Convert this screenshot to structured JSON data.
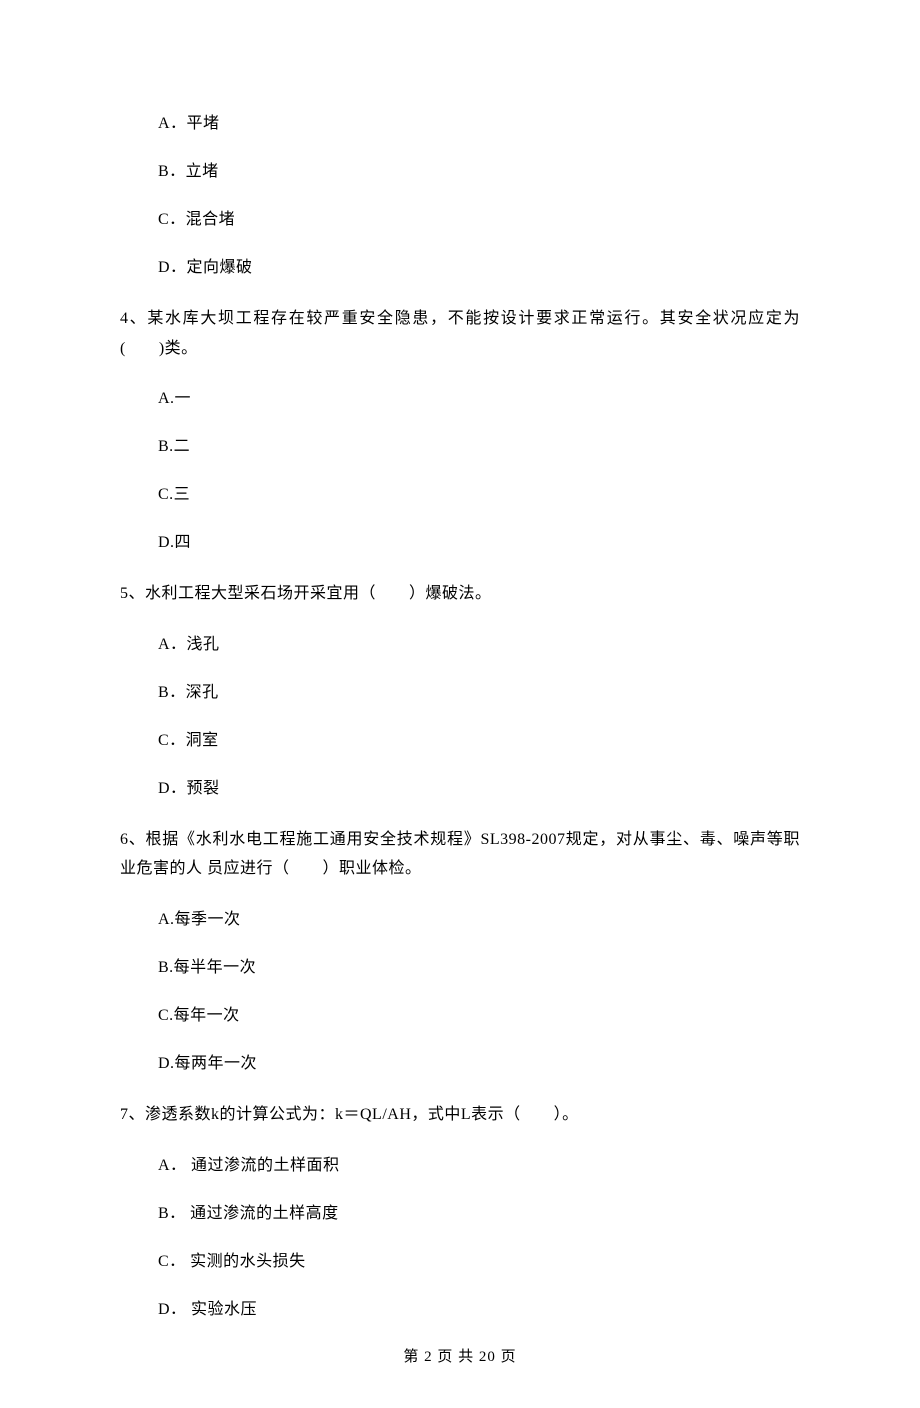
{
  "q3": {
    "options": {
      "a": "A．平堵",
      "b": "B．立堵",
      "c": "C．混合堵",
      "d": "D．定向爆破"
    }
  },
  "q4": {
    "stem": "4、某水库大坝工程存在较严重安全隐患，不能按设计要求正常运行。其安全状况应定为(　　)类。",
    "options": {
      "a": "A.一",
      "b": "B.二",
      "c": "C.三",
      "d": "D.四"
    }
  },
  "q5": {
    "stem": "5、水利工程大型采石场开采宜用（　　）爆破法。",
    "options": {
      "a": "A．浅孔",
      "b": "B．深孔",
      "c": "C．洞室",
      "d": "D．预裂"
    }
  },
  "q6": {
    "stem": "6、根据《水利水电工程施工通用安全技术规程》SL398-2007规定，对从事尘、毒、噪声等职业危害的人 员应进行（　　）职业体检。",
    "options": {
      "a": "A.每季一次",
      "b": "B.每半年一次",
      "c": "C.每年一次",
      "d": "D.每两年一次"
    }
  },
  "q7": {
    "stem": "7、渗透系数k的计算公式为：k＝QL/AH，式中L表示（　　）。",
    "options": {
      "a": "A． 通过渗流的土样面积",
      "b": "B． 通过渗流的土样高度",
      "c": "C． 实测的水头损失",
      "d": "D． 实验水压"
    }
  },
  "footer": "第 2 页 共 20 页"
}
